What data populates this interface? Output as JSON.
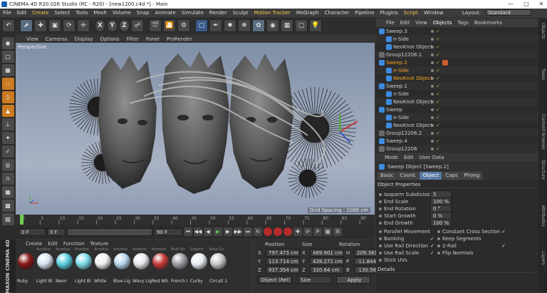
{
  "window": {
    "title": "CINEMA 4D R20.026 Studio (RC - R20) - [new1200.c4d *] - Main"
  },
  "menubar": {
    "items": [
      "File",
      "Edit",
      "Create",
      "Select",
      "Tools",
      "Mesh",
      "Volume",
      "Snap",
      "Animate",
      "Simulate",
      "Render",
      "Sculpt",
      "Motion Tracker",
      "MoGraph",
      "Character",
      "Pipeline",
      "Plugins",
      "Script",
      "Window"
    ],
    "layout_label": "Layout:",
    "layout_value": "Standard"
  },
  "viewport": {
    "menu": [
      "View",
      "Cameras",
      "Display",
      "Options",
      "Filter",
      "Panel",
      "ProRender"
    ],
    "camera_label": "Perspective",
    "grid_spacing": "Grid Spacing : 1000 cm"
  },
  "timeline": {
    "ticks": [
      "0",
      "5",
      "10",
      "15",
      "20",
      "25",
      "30",
      "35",
      "40",
      "45",
      "50",
      "55",
      "60",
      "65",
      "70",
      "75",
      "80",
      "85",
      "90"
    ],
    "frame_label": "0 F"
  },
  "playbar": {
    "start": "0 F",
    "current": "0 F",
    "end": "90 F",
    "end2": "90 F"
  },
  "materials": {
    "menu": [
      "Create",
      "Edit",
      "Function",
      "Texture"
    ],
    "items": [
      {
        "name": "Ruby",
        "tag": "",
        "color": "#8b1a1a"
      },
      {
        "name": "Light Bl",
        "tag": "Anodise",
        "color": "#d8e4f0"
      },
      {
        "name": "Neon",
        "tag": "Anodise",
        "color": "#5ad0e0"
      },
      {
        "name": "Light Bl",
        "tag": "Anodise",
        "color": "#7fdcec"
      },
      {
        "name": "White",
        "tag": "Anodise",
        "color": "#f0f0f0"
      },
      {
        "name": "Blue Lig",
        "tag": "Anodise",
        "color": "#b9d8ee"
      },
      {
        "name": "Wavy Lig",
        "tag": "Anodise",
        "color": "#e8e8ee"
      },
      {
        "name": "Red Wh",
        "tag": "Anodise",
        "color": "#c83a3a"
      },
      {
        "name": "French I",
        "tag": "Beet Bo",
        "color": "#9e9ea6"
      },
      {
        "name": "Curby",
        "tag": "Sapphir",
        "color": "#e8eef5"
      },
      {
        "name": "Circuit 1",
        "tag": "Rose Go",
        "color": "#c8c8cc"
      }
    ],
    "brand": "MAXON CINEMA 4D"
  },
  "coordinates": {
    "headers": {
      "position": "Position",
      "size": "Size",
      "rotation": "Rotation"
    },
    "rows": [
      {
        "axis": "X",
        "pos": "797.473 cm",
        "size_axis": "X",
        "size": "469.901 cm",
        "rot_axis": "H",
        "rot": "209.381 °"
      },
      {
        "axis": "Y",
        "pos": "113.714 cm",
        "size_axis": "Y",
        "size": "428.271 cm",
        "rot_axis": "P",
        "rot": "-11.844 °"
      },
      {
        "axis": "Z",
        "pos": "937.354 cm",
        "size_axis": "Z",
        "size": "320.64 cm",
        "rot_axis": "B",
        "rot": "-130.565 °"
      }
    ],
    "mode": "Object (Rel)",
    "size_mode": "Size",
    "apply": "Apply"
  },
  "objects": {
    "tabs": [
      "File",
      "Edit",
      "View",
      "Objects",
      "Tags",
      "Bookmarks"
    ],
    "active_tab": "Objects",
    "rows": [
      {
        "name": "Sweep.3",
        "indent": 0,
        "color": "#3d8be0",
        "hl": false,
        "tag": false
      },
      {
        "name": "n-Side",
        "indent": 1,
        "color": "#3d8be0",
        "hl": false,
        "tag": false
      },
      {
        "name": "NeoKnot Object",
        "indent": 1,
        "color": "#3d8be0",
        "hl": false,
        "tag": false
      },
      {
        "name": "Group12206.1",
        "indent": 0,
        "color": "#6a6a6a",
        "hl": false,
        "tag": false
      },
      {
        "name": "Sweep.2",
        "indent": 0,
        "color": "#3d8be0",
        "hl": true,
        "tag": true
      },
      {
        "name": "n-Side",
        "indent": 1,
        "color": "#3d8be0",
        "hl": true,
        "tag": false
      },
      {
        "name": "NeoKnot Object",
        "indent": 1,
        "color": "#3d8be0",
        "hl": true,
        "tag": false
      },
      {
        "name": "Sweep.1",
        "indent": 0,
        "color": "#3d8be0",
        "hl": false,
        "tag": false
      },
      {
        "name": "n-Side",
        "indent": 1,
        "color": "#3d8be0",
        "hl": false,
        "tag": false
      },
      {
        "name": "NeoKnot Object",
        "indent": 1,
        "color": "#3d8be0",
        "hl": false,
        "tag": false
      },
      {
        "name": "Sweep",
        "indent": 0,
        "color": "#3d8be0",
        "hl": false,
        "tag": false
      },
      {
        "name": "n-Side",
        "indent": 1,
        "color": "#3d8be0",
        "hl": false,
        "tag": false
      },
      {
        "name": "NeoKnot Object",
        "indent": 1,
        "color": "#3d8be0",
        "hl": false,
        "tag": false
      },
      {
        "name": "Group12206.2",
        "indent": 0,
        "color": "#6a6a6a",
        "hl": false,
        "tag": false
      },
      {
        "name": "Sweep.4",
        "indent": 0,
        "color": "#3d8be0",
        "hl": false,
        "tag": false
      },
      {
        "name": "Group12206",
        "indent": 0,
        "color": "#6a6a6a",
        "hl": false,
        "tag": false
      }
    ]
  },
  "attributes": {
    "menu": [
      "Mode",
      "Edit",
      "User Data"
    ],
    "title": "Sweep Object [Sweep.2]",
    "tabs": [
      "Basic",
      "Coord.",
      "Object",
      "Caps",
      "Phong"
    ],
    "active_tab": "Object",
    "section": "Object Properties",
    "fields": [
      {
        "label": "Isoparm Subdivision",
        "value": "5"
      },
      {
        "label": "End Scale",
        "value": "100 %"
      },
      {
        "label": "End Rotation",
        "value": "0 °"
      },
      {
        "label": "Start Growth",
        "value": "0 %"
      },
      {
        "label": "End Growth",
        "value": "100 %"
      }
    ],
    "checks_left": [
      {
        "label": "Parallel Movement",
        "checked": false
      },
      {
        "label": "Banking",
        "checked": true
      },
      {
        "label": "Use Rail Direction",
        "checked": true
      },
      {
        "label": "Use Rail Scale",
        "checked": true
      },
      {
        "label": "Stick UVs",
        "checked": false
      }
    ],
    "checks_right": [
      {
        "label": "Constant Cross Section",
        "checked": true
      },
      {
        "label": "Keep Segments",
        "checked": false
      },
      {
        "label": "2-Rail",
        "checked": true
      },
      {
        "label": "Flip Normals",
        "checked": false
      }
    ],
    "details": "Details"
  },
  "right_sidebar": [
    "Objects",
    "Takes",
    "Content Browser",
    "Structure",
    "Attributes",
    "Layers"
  ]
}
